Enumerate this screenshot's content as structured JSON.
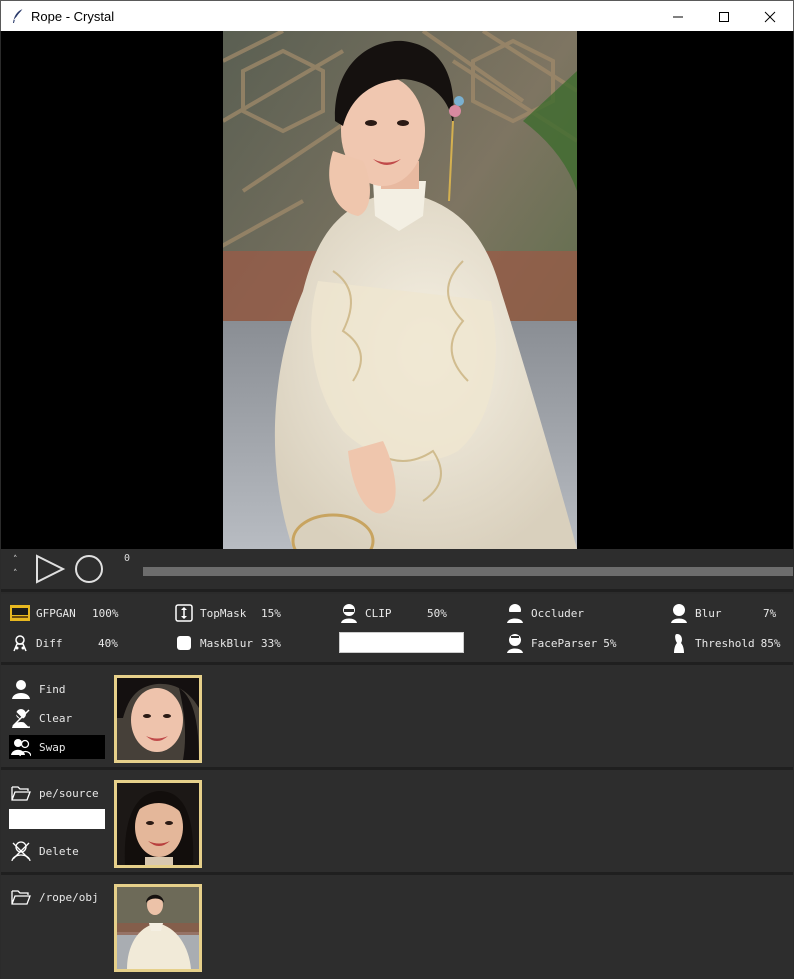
{
  "window": {
    "title": "Rope - Crystal",
    "controls": [
      "minimize-icon",
      "maximize-icon",
      "close-icon"
    ]
  },
  "player": {
    "frame_number": "0",
    "play_icon": "play-icon",
    "record_icon": "record-icon"
  },
  "params": {
    "gfpgan": {
      "label": "GFPGAN",
      "value": "100%"
    },
    "diff": {
      "label": "Diff",
      "value": "40%"
    },
    "topmask": {
      "label": "TopMask",
      "value": "15%"
    },
    "maskblur": {
      "label": "MaskBlur",
      "value": "33%"
    },
    "clip": {
      "label": "CLIP",
      "value": "50%",
      "text_value": ""
    },
    "occluder": {
      "label": "Occluder"
    },
    "faceparser": {
      "label": "FaceParser",
      "value": "5%"
    },
    "blur": {
      "label": "Blur",
      "value": "7%"
    },
    "threshold": {
      "label": "Threshold",
      "value": "85%"
    }
  },
  "faces_panel": {
    "find": "Find",
    "clear": "Clear",
    "swap": "Swap"
  },
  "source_panel": {
    "folder": "pe/source",
    "input_value": "",
    "delete": "Delete"
  },
  "target_panel": {
    "folder": "/rope/obj"
  },
  "colors": {
    "background": "#2d2d2d",
    "thumb_border": "#e6d08a",
    "timeline": "#6d6d6d"
  }
}
